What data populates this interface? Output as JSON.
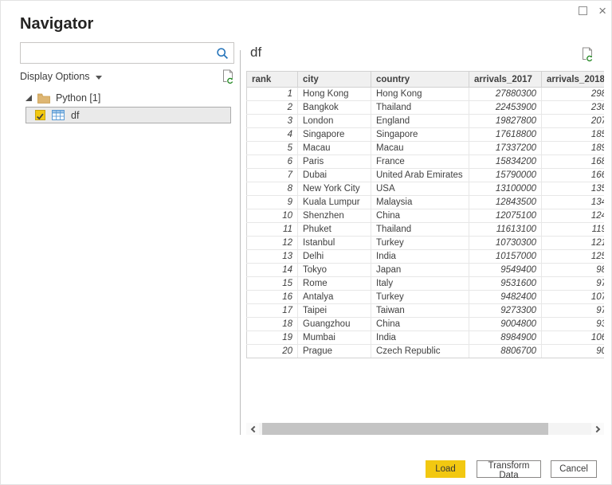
{
  "dialog": {
    "title": "Navigator"
  },
  "search": {
    "value": "",
    "placeholder": ""
  },
  "sidebar": {
    "display_options_label": "Display Options",
    "tree": {
      "folder_label": "Python [1]",
      "item_label": "df",
      "item_checked": true
    }
  },
  "preview": {
    "title": "df",
    "table": {
      "columns": [
        "rank",
        "city",
        "country",
        "arrivals_2017",
        "arrivals_2018"
      ],
      "rows": [
        [
          1,
          "Hong Kong",
          "Hong Kong",
          "27880300",
          "298"
        ],
        [
          2,
          "Bangkok",
          "Thailand",
          "22453900",
          "236"
        ],
        [
          3,
          "London",
          "England",
          "19827800",
          "207"
        ],
        [
          4,
          "Singapore",
          "Singapore",
          "17618800",
          "185"
        ],
        [
          5,
          "Macau",
          "Macau",
          "17337200",
          "189"
        ],
        [
          6,
          "Paris",
          "France",
          "15834200",
          "168"
        ],
        [
          7,
          "Dubai",
          "United Arab Emirates",
          "15790000",
          "166"
        ],
        [
          8,
          "New York City",
          "USA",
          "13100000",
          "135"
        ],
        [
          9,
          "Kuala Lumpur",
          "Malaysia",
          "12843500",
          "134"
        ],
        [
          10,
          "Shenzhen",
          "China",
          "12075100",
          "124"
        ],
        [
          11,
          "Phuket",
          "Thailand",
          "11613100",
          "119"
        ],
        [
          12,
          "Istanbul",
          "Turkey",
          "10730300",
          "121"
        ],
        [
          13,
          "Delhi",
          "India",
          "10157000",
          "125"
        ],
        [
          14,
          "Tokyo",
          "Japan",
          "9549400",
          "98"
        ],
        [
          15,
          "Rome",
          "Italy",
          "9531600",
          "97"
        ],
        [
          16,
          "Antalya",
          "Turkey",
          "9482400",
          "107"
        ],
        [
          17,
          "Taipei",
          "Taiwan",
          "9273300",
          "97"
        ],
        [
          18,
          "Guangzhou",
          "China",
          "9004800",
          "93"
        ],
        [
          19,
          "Mumbai",
          "India",
          "8984900",
          "106"
        ],
        [
          20,
          "Prague",
          "Czech Republic",
          "8806700",
          "90"
        ]
      ]
    }
  },
  "footer": {
    "load_label": "Load",
    "transform_label": "Transform Data",
    "cancel_label": "Cancel"
  },
  "colors": {
    "accent_yellow": "#f2c811",
    "refresh_green": "#218721",
    "search_blue": "#2272b9",
    "selected_row_bg": "#eaeaea"
  }
}
